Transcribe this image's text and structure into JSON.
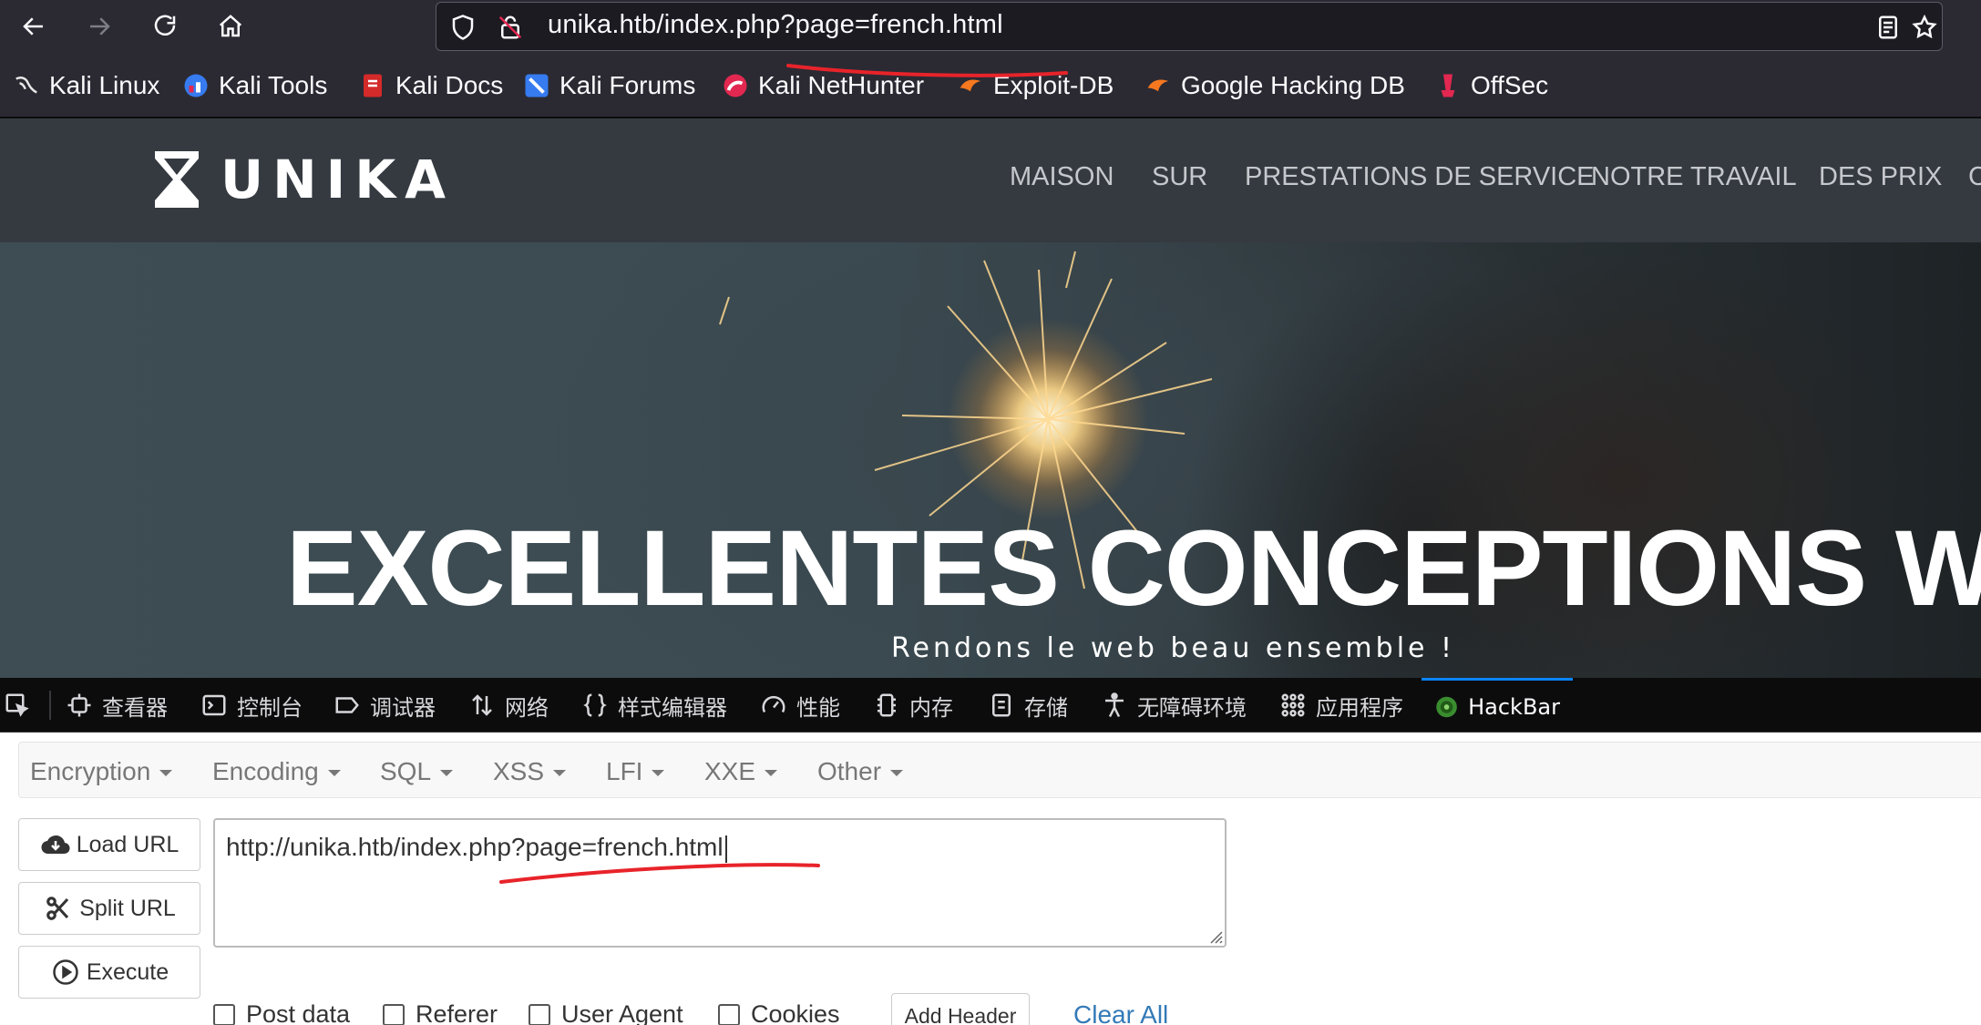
{
  "browser": {
    "url": "unika.htb/index.php?page=french.html"
  },
  "bookmarks": [
    {
      "label": "Kali Linux",
      "icon": "kali-dragon-icon"
    },
    {
      "label": "Kali Tools",
      "icon": "kali-tools-icon"
    },
    {
      "label": "Kali Docs",
      "icon": "kali-docs-icon"
    },
    {
      "label": "Kali Forums",
      "icon": "kali-forums-icon"
    },
    {
      "label": "Kali NetHunter",
      "icon": "kali-nethunter-icon"
    },
    {
      "label": "Exploit-DB",
      "icon": "exploit-db-icon"
    },
    {
      "label": "Google Hacking DB",
      "icon": "ghdb-icon"
    },
    {
      "label": "OffSec",
      "icon": "offsec-icon"
    }
  ],
  "site": {
    "logo_text": "UNIKA",
    "menu": [
      "MAISON",
      "SUR",
      "PRESTATIONS DE SERVICE",
      "NOTRE TRAVAIL",
      "DES PRIX",
      "C"
    ],
    "hero_title": "EXCELLENTES CONCEPTIONS WEB",
    "hero_subtitle": "Rendons le web beau ensemble !"
  },
  "devtools": {
    "tabs": [
      "查看器",
      "控制台",
      "调试器",
      "网络",
      "样式编辑器",
      "性能",
      "内存",
      "存储",
      "无障碍环境",
      "应用程序",
      "HackBar"
    ],
    "active_tab": "HackBar"
  },
  "hackbar": {
    "menu": [
      "Encryption",
      "Encoding",
      "SQL",
      "XSS",
      "LFI",
      "XXE",
      "Other"
    ],
    "buttons": {
      "load": "Load URL",
      "split": "Split URL",
      "execute": "Execute"
    },
    "url_value": "http://unika.htb/index.php?page=french.html",
    "checkboxes": [
      "Post data",
      "Referer",
      "User Agent",
      "Cookies"
    ],
    "add_header": "Add Header",
    "clear_all": "Clear All"
  },
  "colors": {
    "annotation": "#e8232a",
    "devtools_accent": "#0a84ff",
    "link": "#337ab7"
  }
}
